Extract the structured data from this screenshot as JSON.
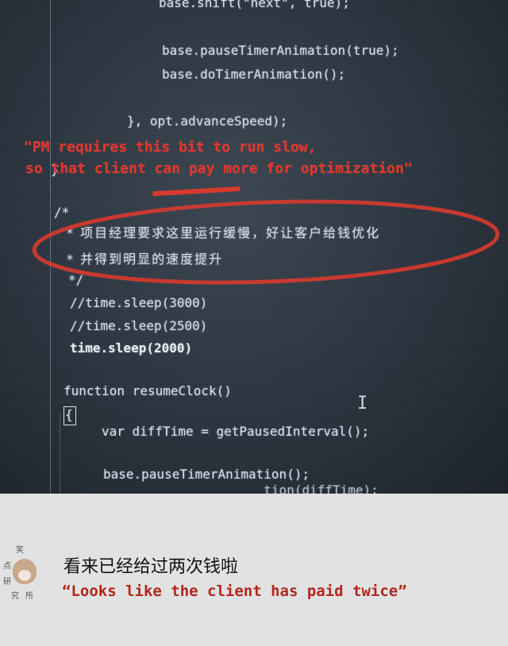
{
  "code_lines_top": [
    "base.shift(\"next\", true);",
    "base.pauseTimerAnimation(true);",
    "base.doTimerAnimation();",
    "}, opt.advanceSpeed);",
    "}"
  ],
  "annotation_en": {
    "line1": "\"PM requires this bit to run slow,",
    "line2": "so that client can pay more for optimization\""
  },
  "comment_block": {
    "open": "/*",
    "line1": "* 项目经理要求这里运行缓慢，好让客户给钱优化",
    "line2": "* 并得到明显的速度提升",
    "close": "*/"
  },
  "code_lines_bottom": [
    "//time.sleep(3000)",
    "//time.sleep(2500)",
    "time.sleep(2000)",
    "function resumeClock()",
    "{",
    "var diffTime = getPausedInterval();",
    "base.pauseTimerAnimation();",
    "                     tion(diffTime);"
  ],
  "caption": {
    "chinese": "看来已经给过两次钱啦",
    "english": "“Looks like the client has paid twice”"
  },
  "logo": {
    "chars": [
      "笑",
      "点",
      "研",
      "究",
      "所"
    ]
  },
  "colors": {
    "annotation_red": "#e0362c",
    "caption_red": "#b3261e",
    "screen_bg": "#2a333d",
    "caption_bg": "#e2e2e2"
  }
}
